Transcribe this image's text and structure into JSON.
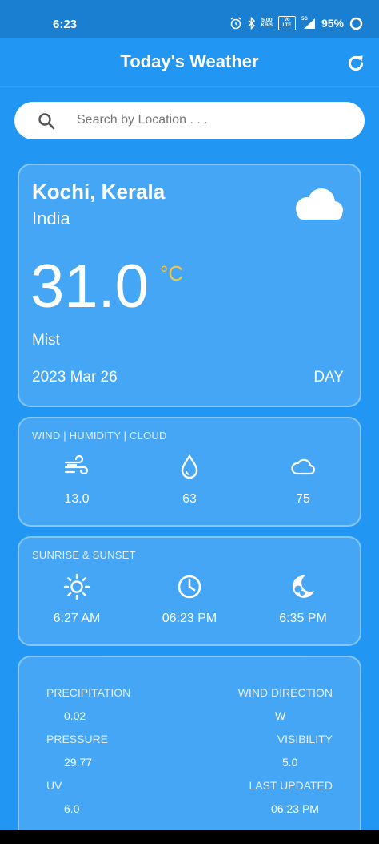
{
  "status_bar": {
    "time": "6:23",
    "net_speed_top": "5.00",
    "net_speed_unit": "KB/S",
    "volte": "Vo LTE",
    "signal_label": "5G",
    "battery": "95%"
  },
  "app_bar": {
    "title": "Today's Weather",
    "refresh_icon": "refresh-icon"
  },
  "search": {
    "placeholder": "Search by Location . . .",
    "value": "",
    "icon": "search-icon"
  },
  "current": {
    "city": "Kochi, Kerala",
    "country": "India",
    "temperature": "31.0",
    "unit": "°C",
    "condition": "Mist",
    "date": "2023 Mar 26",
    "day_flag": "DAY",
    "condition_icon": "cloud-icon",
    "unit_color": "#f2c744"
  },
  "wind_humidity_cloud": {
    "label": "WIND | HUMIDITY | CLOUD",
    "items": [
      {
        "icon": "wind-icon",
        "value": "13.0"
      },
      {
        "icon": "humidity-drop-icon",
        "value": "63"
      },
      {
        "icon": "cloud-icon",
        "value": "75"
      }
    ]
  },
  "sunrise_sunset": {
    "label": "SUNRISE & SUNSET",
    "items": [
      {
        "icon": "sun-icon",
        "value": "6:27 AM"
      },
      {
        "icon": "clock-icon",
        "value": "06:23 PM"
      },
      {
        "icon": "moon-icon",
        "value": "6:35 PM"
      }
    ]
  },
  "details": {
    "precipitation_label": "PRECIPITATION",
    "precipitation_value": "0.02",
    "wind_direction_label": "WIND DIRECTION",
    "wind_direction_value": "W",
    "pressure_label": "PRESSURE",
    "pressure_value": "29.77",
    "visibility_label": "VISIBILITY",
    "visibility_value": "5.0",
    "uv_label": "UV",
    "uv_value": "6.0",
    "last_updated_label": "LAST UPDATED",
    "last_updated_value": "06:23 PM"
  }
}
